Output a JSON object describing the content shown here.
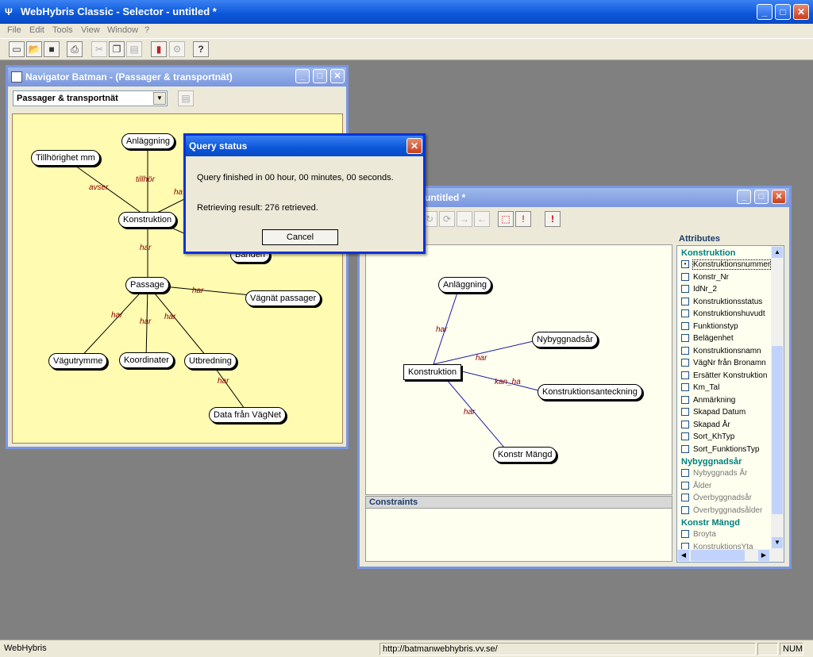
{
  "app": {
    "title": "WebHybris Classic - Selector - untitled *"
  },
  "menu": [
    "File",
    "Edit",
    "Tools",
    "View",
    "Window",
    "?"
  ],
  "navigator": {
    "title": "Navigator Batman - (Passager & transportnät)",
    "dropdown_value": "Passager & transportnät",
    "nodes": {
      "tillhorighet": "Tillhörighet mm",
      "anlaggning": "Anläggning",
      "konstruktion": "Konstruktion",
      "banden": "Banden",
      "passage": "Passage",
      "vagnat_passager": "Vägnät passager",
      "vagutrymme": "Vägutrymme",
      "koordinater": "Koordinater",
      "utbredning": "Utbredning",
      "data_fran_vagnet": "Data från VägNet"
    },
    "edges": {
      "avser": "avser",
      "tillhor": "tillhör",
      "ha": "ha",
      "har1": "har",
      "har2": "har",
      "har3": "har",
      "har4": "har",
      "har5": "har",
      "har6": "har"
    }
  },
  "selector": {
    "title": "untitled *",
    "nodes": {
      "anlaggning": "Anläggning",
      "konstruktion": "Konstruktion",
      "nybyggnadsar": "Nybyggnadsår",
      "konstruktionsanteckning": "Konstruktionsanteckning",
      "konstr_mangd": "Konstr Mängd"
    },
    "edges": {
      "har1": "har",
      "har2": "har",
      "kan_ha": "kan_ha",
      "har3": "har"
    },
    "constraints_label": "Constraints",
    "attributes_label": "Attributes",
    "attribute_groups": [
      {
        "name": "Konstruktion",
        "items": [
          {
            "label": "Konstruktionsnummer",
            "checked": true
          },
          {
            "label": "Konstr_Nr",
            "checked": false
          },
          {
            "label": "IdNr_2",
            "checked": false
          },
          {
            "label": "Konstruktionsstatus",
            "checked": false
          },
          {
            "label": "Konstruktionshuvudt",
            "checked": false
          },
          {
            "label": "Funktionstyp",
            "checked": false
          },
          {
            "label": "Belägenhet",
            "checked": false
          },
          {
            "label": "Konstruktionsnamn",
            "checked": false
          },
          {
            "label": "VägNr från Bronamn",
            "checked": false
          },
          {
            "label": "Ersätter Konstruktion",
            "checked": false
          },
          {
            "label": "Km_Tal",
            "checked": false
          },
          {
            "label": "Anmärkning",
            "checked": false
          },
          {
            "label": "Skapad Datum",
            "checked": false
          },
          {
            "label": "Skapad År",
            "checked": false
          },
          {
            "label": "Sort_KhTyp",
            "checked": false
          },
          {
            "label": "Sort_FunktionsTyp",
            "checked": false
          }
        ]
      },
      {
        "name": "Nybyggnadsår",
        "items": [
          {
            "label": "Nybyggnads År",
            "checked": false
          },
          {
            "label": "Ålder",
            "checked": false
          },
          {
            "label": "Överbyggnadsår",
            "checked": false
          },
          {
            "label": "Överbyggnadsålder",
            "checked": false
          }
        ]
      },
      {
        "name": "Konstr Mängd",
        "items": [
          {
            "label": "Broyta",
            "checked": false
          },
          {
            "label": "KonstruktionsYta",
            "checked": false
          }
        ]
      }
    ]
  },
  "dialog": {
    "title": "Query status",
    "line1": "Query finished in  00 hour, 00 minutes, 00 seconds.",
    "line2": "Retrieving result: 276 retrieved.",
    "cancel": "Cancel"
  },
  "status": {
    "app": "WebHybris",
    "url": "http://batmanwebhybris.vv.se/",
    "num": "NUM"
  }
}
